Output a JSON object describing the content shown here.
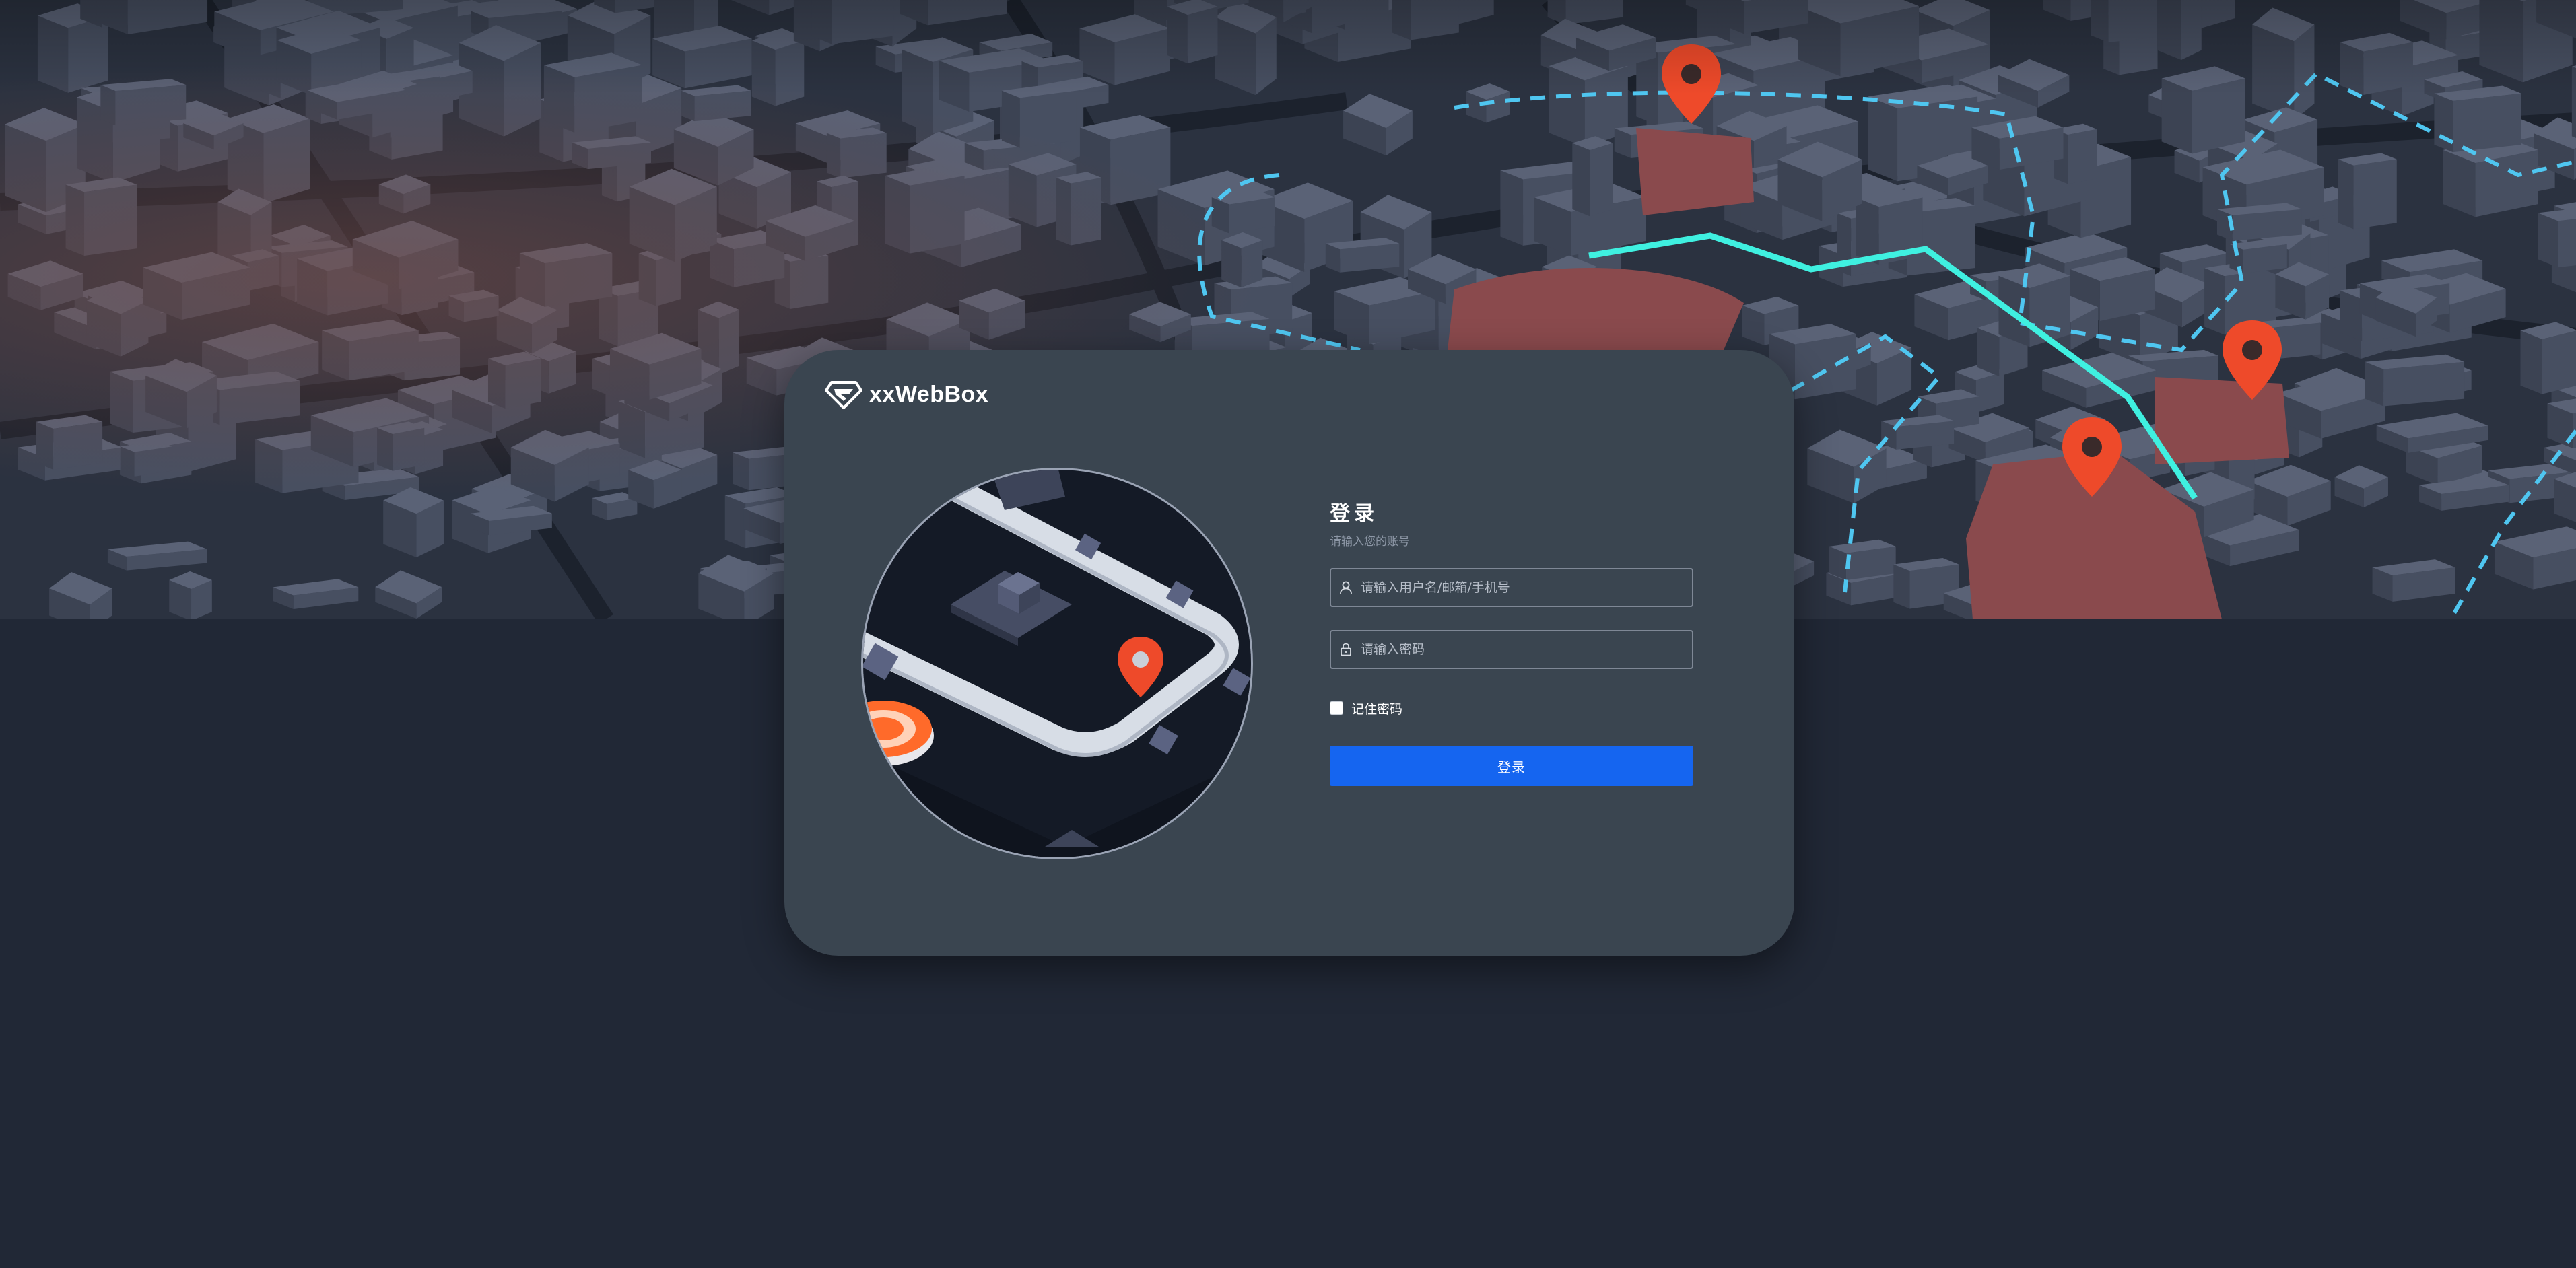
{
  "brand": {
    "name": "xxWebBox",
    "logo_icon": "gem-diamond-logo"
  },
  "login": {
    "title": "登录",
    "subtitle": "请输入您的账号",
    "username_placeholder": "请输入用户名/邮箱/手机号",
    "username_icon": "user-icon",
    "password_placeholder": "请输入密码",
    "password_icon": "lock-icon",
    "remember_label": "记住密码",
    "remember_checked": false,
    "submit_label": "登录"
  },
  "background": {
    "description_icon": "city-map-illustration",
    "pin_icon": "map-pin-icon"
  },
  "colors": {
    "page_bg": "#212836",
    "card_bg": "#3a4550",
    "primary": "#1565f0",
    "route_solid": "#3ff0e0",
    "route_dashed": "#4fc6f0",
    "pin": "#ee4a2a",
    "highlight_building": "#8a4a4d"
  }
}
